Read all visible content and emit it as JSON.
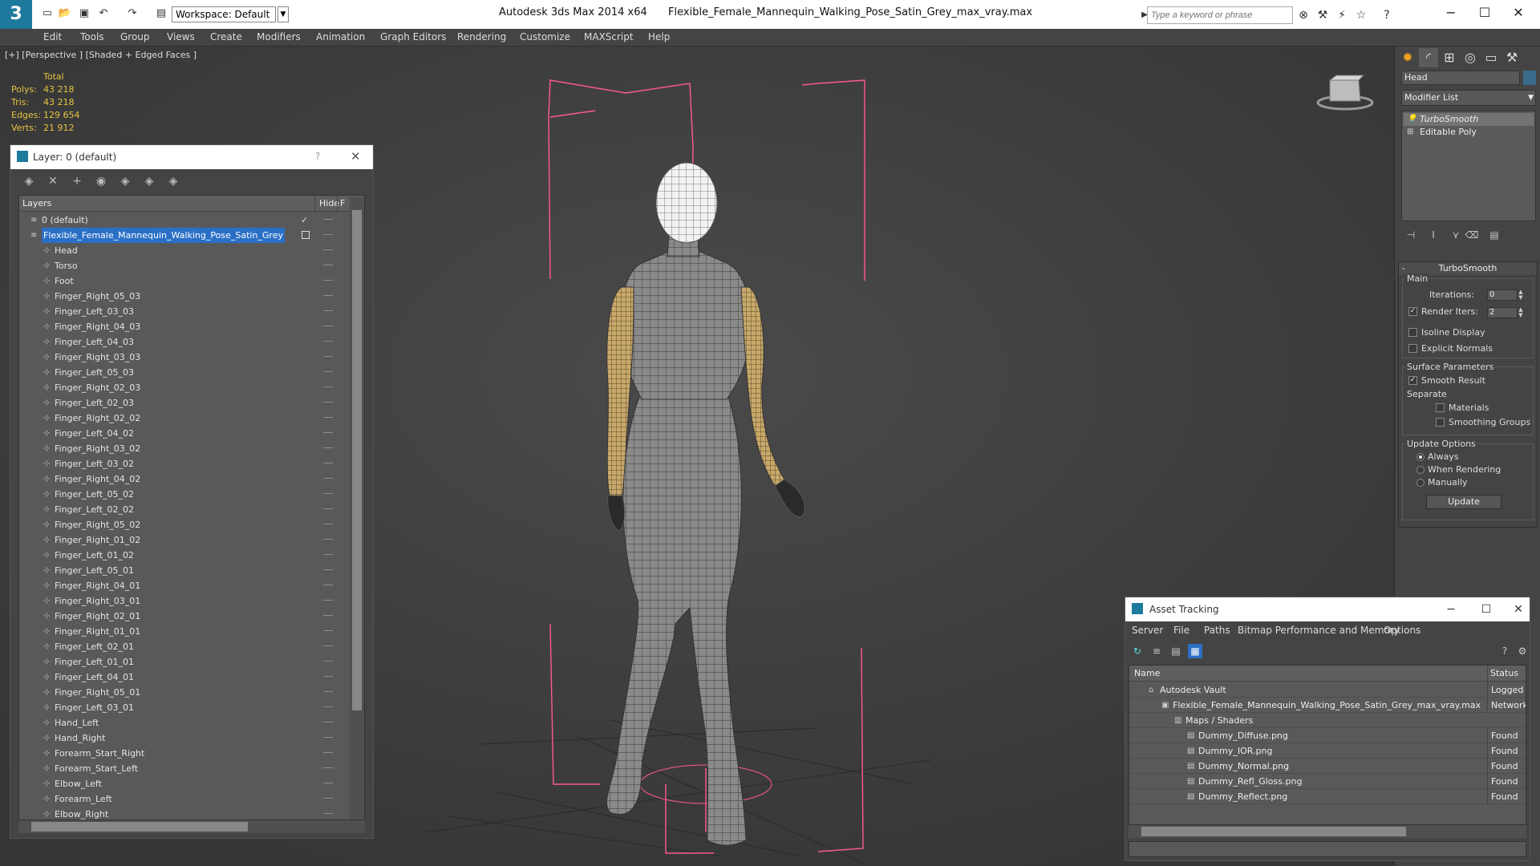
{
  "titlebar": {
    "app_title": "Autodesk 3ds Max  2014 x64",
    "file_name": "Flexible_Female_Mannequin_Walking_Pose_Satin_Grey_max_vray.max",
    "workspace": "Workspace: Default",
    "search_placeholder": "Type a keyword or phrase"
  },
  "menu": [
    "Edit",
    "Tools",
    "Group",
    "Views",
    "Create",
    "Modifiers",
    "Animation",
    "Graph Editors",
    "Rendering",
    "Customize",
    "MAXScript",
    "Help"
  ],
  "viewport": {
    "label": "[+] [Perspective ] [Shaded + Edged Faces ]",
    "stats": {
      "header": "Total",
      "rows": [
        {
          "label": "Polys:",
          "value": "43 218"
        },
        {
          "label": "Tris:",
          "value": "43 218"
        },
        {
          "label": "Edges:",
          "value": "129 654"
        },
        {
          "label": "Verts:",
          "value": "21 912"
        }
      ]
    }
  },
  "layer_explorer": {
    "title": "Layer: 0 (default)",
    "help": "?",
    "columns": {
      "layers": "Layers",
      "hide": "Hide",
      "freeze": "F"
    },
    "rows": [
      {
        "name": "0 (default)",
        "level": 0,
        "checked": true
      },
      {
        "name": "Flexible_Female_Mannequin_Walking_Pose_Satin_Grey",
        "level": 0,
        "selected": true
      },
      {
        "name": "Head",
        "level": 1
      },
      {
        "name": "Torso",
        "level": 1
      },
      {
        "name": "Foot",
        "level": 1
      },
      {
        "name": "Finger_Right_05_03",
        "level": 1
      },
      {
        "name": "Finger_Left_03_03",
        "level": 1
      },
      {
        "name": "Finger_Right_04_03",
        "level": 1
      },
      {
        "name": "Finger_Left_04_03",
        "level": 1
      },
      {
        "name": "Finger_Right_03_03",
        "level": 1
      },
      {
        "name": "Finger_Left_05_03",
        "level": 1
      },
      {
        "name": "Finger_Right_02_03",
        "level": 1
      },
      {
        "name": "Finger_Left_02_03",
        "level": 1
      },
      {
        "name": "Finger_Right_02_02",
        "level": 1
      },
      {
        "name": "Finger_Left_04_02",
        "level": 1
      },
      {
        "name": "Finger_Right_03_02",
        "level": 1
      },
      {
        "name": "Finger_Left_03_02",
        "level": 1
      },
      {
        "name": "Finger_Right_04_02",
        "level": 1
      },
      {
        "name": "Finger_Left_05_02",
        "level": 1
      },
      {
        "name": "Finger_Left_02_02",
        "level": 1
      },
      {
        "name": "Finger_Right_05_02",
        "level": 1
      },
      {
        "name": "Finger_Right_01_02",
        "level": 1
      },
      {
        "name": "Finger_Left_01_02",
        "level": 1
      },
      {
        "name": "Finger_Left_05_01",
        "level": 1
      },
      {
        "name": "Finger_Right_04_01",
        "level": 1
      },
      {
        "name": "Finger_Right_03_01",
        "level": 1
      },
      {
        "name": "Finger_Right_02_01",
        "level": 1
      },
      {
        "name": "Finger_Right_01_01",
        "level": 1
      },
      {
        "name": "Finger_Left_02_01",
        "level": 1
      },
      {
        "name": "Finger_Left_01_01",
        "level": 1
      },
      {
        "name": "Finger_Left_04_01",
        "level": 1
      },
      {
        "name": "Finger_Right_05_01",
        "level": 1
      },
      {
        "name": "Finger_Left_03_01",
        "level": 1
      },
      {
        "name": "Hand_Left",
        "level": 1
      },
      {
        "name": "Hand_Right",
        "level": 1
      },
      {
        "name": "Forearm_Start_Right",
        "level": 1
      },
      {
        "name": "Forearm_Start_Left",
        "level": 1
      },
      {
        "name": "Elbow_Left",
        "level": 1
      },
      {
        "name": "Forearm_Left",
        "level": 1
      },
      {
        "name": "Elbow_Right",
        "level": 1
      }
    ]
  },
  "command_panel": {
    "object_name": "Head",
    "modifier_list": "Modifier List",
    "stack": [
      "TurboSmooth",
      "Editable Poly"
    ],
    "turbosmooth": {
      "title": "TurboSmooth",
      "main": "Main",
      "iterations_label": "Iterations:",
      "iterations": "0",
      "render_iters_label": "Render Iters:",
      "render_iters": "2",
      "isoline": "Isoline Display",
      "explicit_normals": "Explicit Normals",
      "surface_params": "Surface Parameters",
      "smooth_result": "Smooth Result",
      "separate": "Separate",
      "materials": "Materials",
      "smoothing_groups": "Smoothing Groups",
      "update_options": "Update Options",
      "always": "Always",
      "when_rendering": "When Rendering",
      "manually": "Manually",
      "update": "Update"
    }
  },
  "asset_tracking": {
    "title": "Asset Tracking",
    "menu": [
      "Server",
      "File",
      "Paths",
      "Bitmap Performance and Memory",
      "Options"
    ],
    "columns": {
      "name": "Name",
      "status": "Status"
    },
    "rows": [
      {
        "name": "Autodesk Vault",
        "status": "Logged C",
        "level": 0
      },
      {
        "name": "Flexible_Female_Mannequin_Walking_Pose_Satin_Grey_max_vray.max",
        "status": "Network I",
        "level": 1
      },
      {
        "name": "Maps / Shaders",
        "status": "",
        "level": 2
      },
      {
        "name": "Dummy_Diffuse.png",
        "status": "Found",
        "level": 3
      },
      {
        "name": "Dummy_IOR.png",
        "status": "Found",
        "level": 3
      },
      {
        "name": "Dummy_Normal.png",
        "status": "Found",
        "level": 3
      },
      {
        "name": "Dummy_Refl_Gloss.png",
        "status": "Found",
        "level": 3
      },
      {
        "name": "Dummy_Reflect.png",
        "status": "Found",
        "level": 3
      }
    ]
  },
  "colors": {
    "selection": "#2a6fc6",
    "stats": "#e6c440",
    "bbox": "#ff5a8a",
    "wire": "#7a7a7a",
    "bone": "#c9a96a"
  }
}
